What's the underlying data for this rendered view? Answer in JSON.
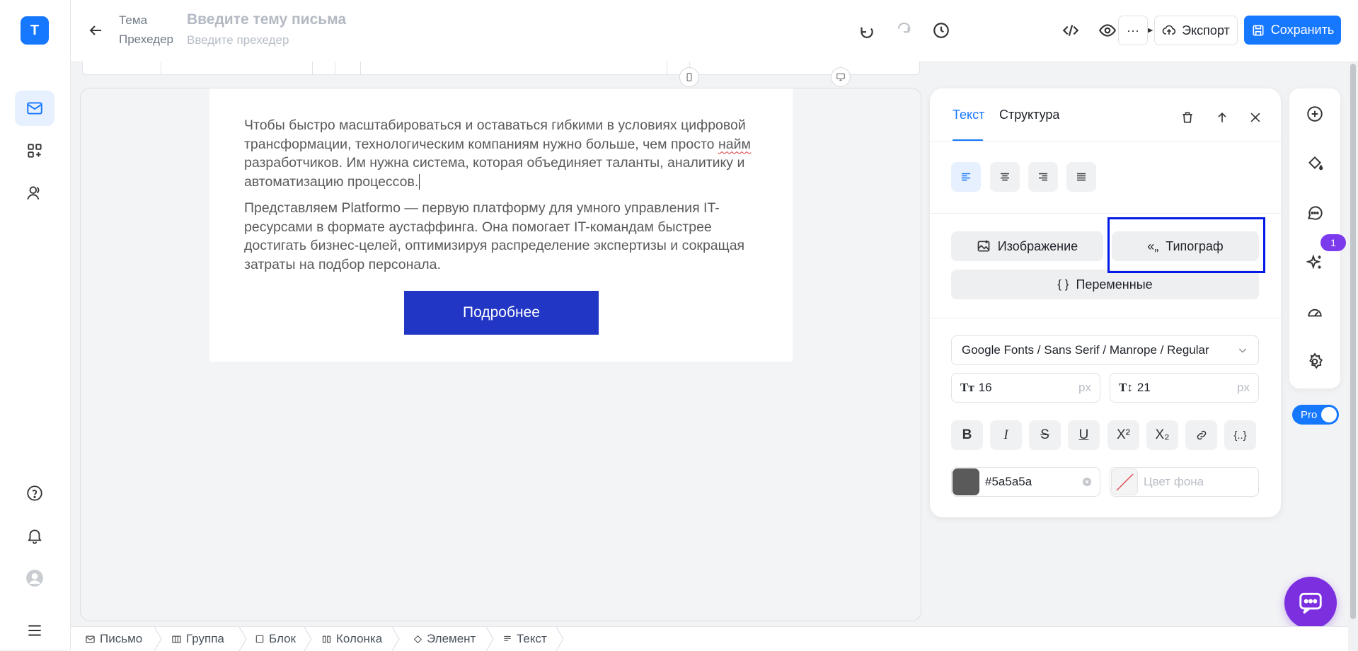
{
  "app": {
    "logo_letter": "T"
  },
  "header": {
    "subject_label": "Тема",
    "subject_placeholder": "Введите тему письма",
    "preheader_label": "Прехедер",
    "preheader_placeholder": "Введите прехедер",
    "more_label": "···",
    "export_label": "Экспорт",
    "save_label": "Сохранить"
  },
  "email": {
    "paragraph1_before": "Чтобы быстро масштабироваться и оставаться гибкими в условиях цифровой трансформации, технологическим компаниям нужно больше, чем просто ",
    "paragraph1_word": "найм",
    "paragraph1_after": " разработчиков. Им нужна система, которая объединяет таланты, аналитику и автоматизацию процессов.",
    "paragraph2": "Представляем Platformo — первую платформу для умного управления IT-ресурсами в формате аустаффинга. Она помогает IT-командам быстрее достигать бизнес-целей, оптимизируя распределение экспертизы и сокращая затраты на подбор персонала.",
    "button_label": "Подробнее",
    "button_color": "#2136c5"
  },
  "panel": {
    "tabs": [
      {
        "label": "Текст"
      },
      {
        "label": "Структура"
      }
    ],
    "image_button": "Изображение",
    "typograph_button": "Типограф",
    "variables_button": "Переменные",
    "font_value": "Google Fonts / Sans Serif / Manrope / Regular",
    "font_size_label": "Tт",
    "font_size": "16",
    "line_height_label": "T↕",
    "line_height": "21",
    "unit": "px",
    "format_buttons": [
      "B",
      "I",
      "S",
      "U",
      "X²",
      "X₂"
    ],
    "text_color": "#5a5a5a",
    "bg_color_placeholder": "Цвет фона"
  },
  "right_toolbar": {
    "badge_count": "1",
    "pro_label": "Pro"
  },
  "breadcrumbs": [
    {
      "label": "Письмо"
    },
    {
      "label": "Группа"
    },
    {
      "label": "Блок"
    },
    {
      "label": "Колонка"
    },
    {
      "label": "Элемент"
    },
    {
      "label": "Текст"
    }
  ],
  "colors": {
    "accent": "#1677ff",
    "highlight": "#0019e6",
    "chat_fab": "#7b2fdf"
  }
}
